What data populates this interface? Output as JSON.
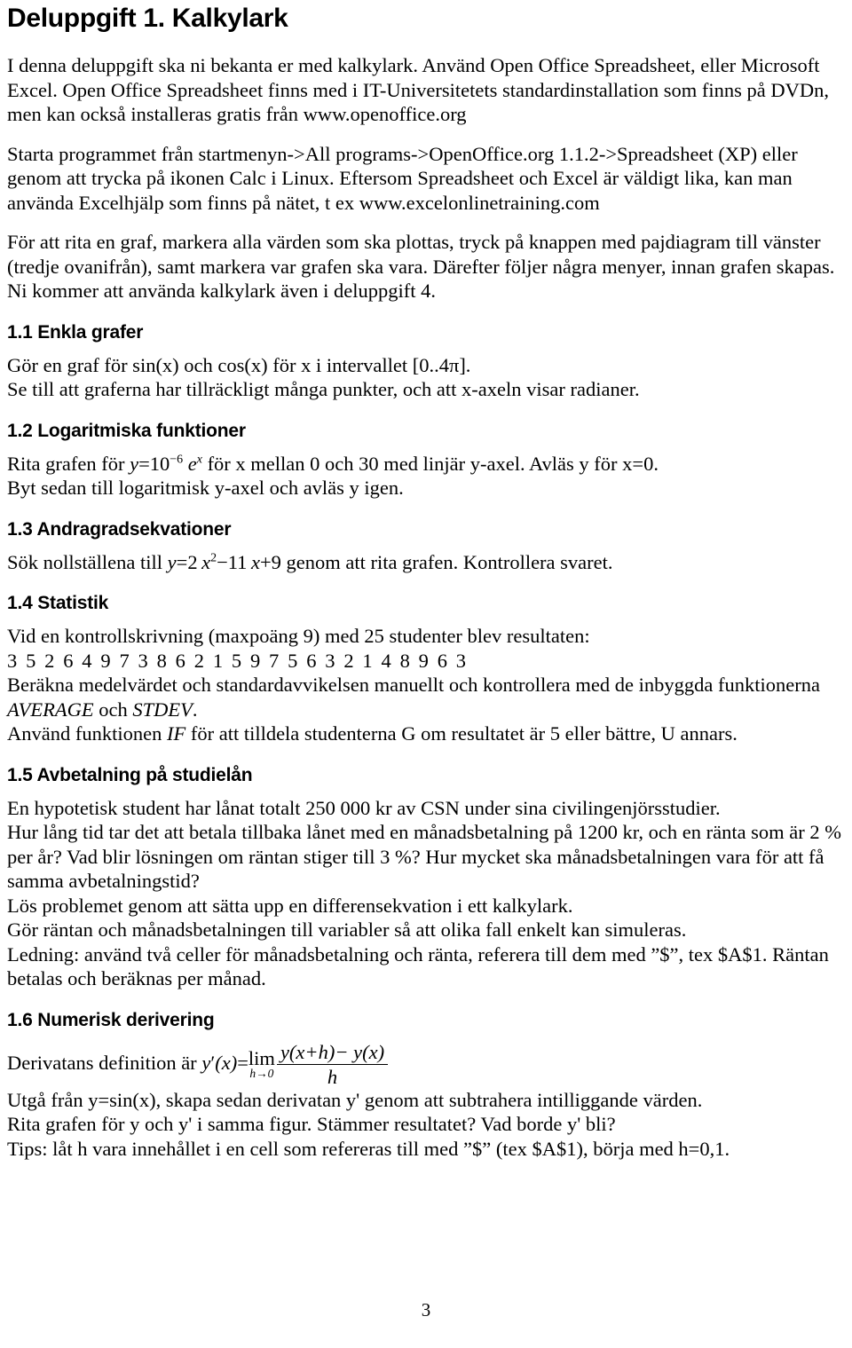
{
  "document": {
    "title": "Deluppgift 1. Kalkylark",
    "page_number": "3"
  },
  "intro": {
    "paragraph_1": "I denna deluppgift ska ni bekanta er med kalkylark. Använd Open Office Spreadsheet, eller Microsoft Excel. Open Office Spreadsheet finns med i IT-Universitetets standardinstallation som finns på DVDn, men kan också installeras gratis från www.openoffice.org",
    "paragraph_2": "Starta programmet från startmenyn->All programs->OpenOffice.org 1.1.2->Spreadsheet (XP) eller genom att trycka på ikonen Calc i Linux. Eftersom Spreadsheet och Excel är väldigt lika, kan man använda Excelhjälp som finns på nätet, t ex www.excelonlinetraining.com",
    "paragraph_3": "För att rita en graf, markera alla värden som ska plottas, tryck på knappen med pajdiagram till vänster (tredje ovanifrån), samt markera var grafen ska vara. Därefter följer några menyer, innan grafen skapas. Ni kommer att använda kalkylark även i deluppgift 4."
  },
  "sections": {
    "s11": {
      "heading": "1.1 Enkla grafer",
      "line_1": "Gör en graf för sin(x) och cos(x) för x i intervallet [0..4π].",
      "line_2": "Se till att graferna har tillräckligt många punkter, och att x-axeln visar radianer."
    },
    "s12": {
      "heading": "1.2 Logaritmiska funktioner",
      "line_1_before": "Rita grafen för",
      "formula": "y=10⁻⁶ eˣ",
      "formula_parts": {
        "lhs": "y",
        "equals": "=",
        "base": "10",
        "exponent": "−6",
        "e": "e",
        "e_exponent": "x"
      },
      "line_1_after": "för x mellan 0 och 30 med linjär y-axel. Avläs y för x=0.",
      "line_2": "Byt sedan till logaritmisk y-axel och avläs y igen."
    },
    "s13": {
      "heading": "1.3 Andragradsekvationer",
      "line_1_before": "Sök nollställena till",
      "formula": "y=2x²−11x+9",
      "formula_parts": {
        "lhs": "y",
        "equals": "=",
        "coef": "2",
        "var": "x",
        "power": "2",
        "minus": "−",
        "b_coef": "11",
        "b_var": "x",
        "plus": "+",
        "c": "9"
      },
      "line_1_after": "genom att rita grafen. Kontrollera svaret."
    },
    "s14": {
      "heading": "1.4 Statistik",
      "line_1": "Vid en kontrollskrivning (maxpoäng 9) med 25 studenter blev resultaten:",
      "data_values": "3 5 2 6 4 9 7 3 8 6 2 1 5 9 7 5 6 3 2 1 4 8 9 6 3",
      "line_3_before": "Beräkna medelvärdet och standardavvikelsen manuellt och kontrollera med de inbyggda funktionerna",
      "function_average": "AVERAGE",
      "line_3_mid": "och",
      "function_stdev": "STDEV",
      "line_3_after": ".",
      "line_4_before": "Använd funktionen",
      "function_if": "IF",
      "line_4_after": "för att tilldela studenterna G om resultatet är 5 eller bättre, U annars."
    },
    "s15": {
      "heading": "1.5 Avbetalning på studielån",
      "line_1": "En hypotetisk student har lånat totalt 250 000 kr av CSN under sina civilingenjörsstudier.",
      "line_2": "Hur lång tid tar det att betala tillbaka lånet med en månadsbetalning på 1200 kr, och en ränta som är 2 % per år? Vad blir lösningen om räntan stiger till 3 %? Hur mycket ska månadsbetalningen vara för att få samma avbetalningstid?",
      "line_3": "Lös problemet genom att sätta upp en differensekvation i ett kalkylark.",
      "line_4": "Gör räntan och månadsbetalningen till variabler så att olika fall enkelt kan simuleras.",
      "line_5": "Ledning: använd två celler för månadsbetalning och ränta, referera till dem med ”$”, tex $A$1. Räntan betalas och beräknas per månad."
    },
    "s16": {
      "heading": "1.6 Numerisk derivering",
      "line_1_before": "Derivatans definition är",
      "formula_parts": {
        "y": "y",
        "prime": "′",
        "arg": "(x)",
        "equals": "=",
        "lim": "lim",
        "lim_sub": "h→0",
        "numerator": "y(x+h)− y(x)",
        "denominator": "h"
      },
      "line_2": "Utgå från y=sin(x), skapa sedan derivatan y' genom att subtrahera intilliggande värden.",
      "line_3": "Rita grafen för y och y' i samma figur. Stämmer resultatet? Vad borde y' bli?",
      "line_4": "Tips: låt h vara innehållet i en cell som refereras till med ”$” (tex $A$1), börja med h=0,1."
    }
  }
}
